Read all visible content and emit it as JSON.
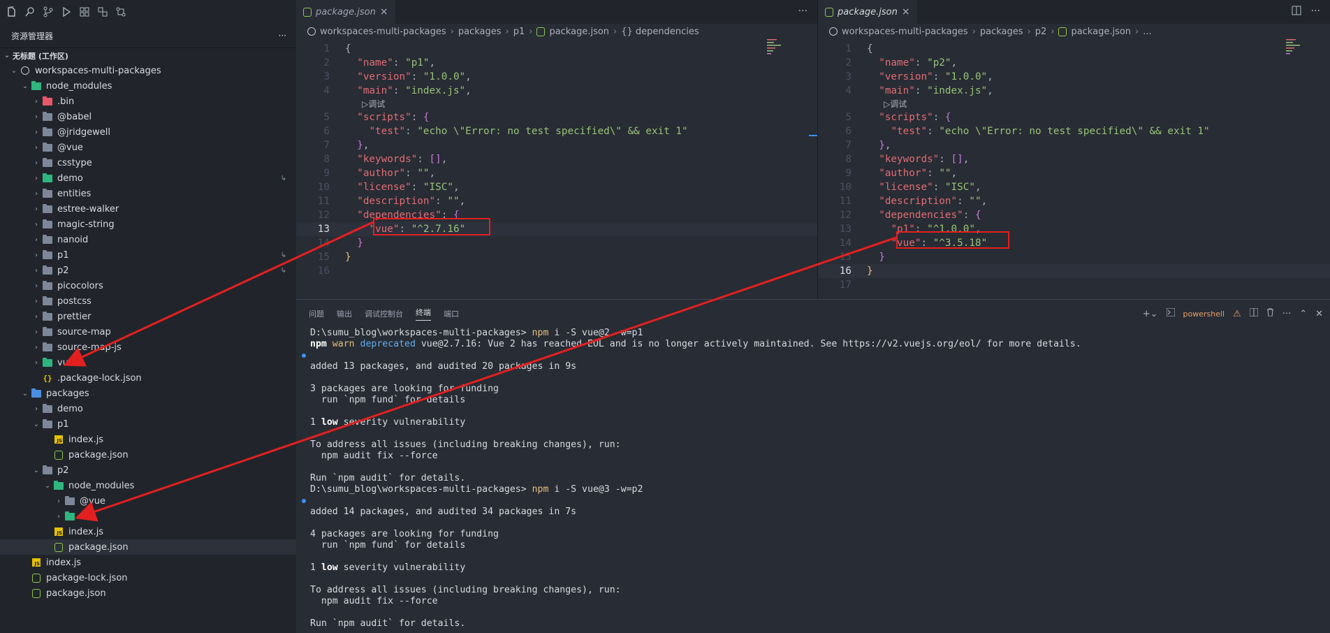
{
  "sidebar": {
    "explorer_title": "资源管理器",
    "more": "···",
    "workspace_title": "无标题 (工作区)",
    "tree": [
      {
        "label": "workspaces-multi-packages",
        "depth": 0,
        "chev": "v",
        "icon": "circle",
        "name": "tree-root"
      },
      {
        "label": "node_modules",
        "depth": 1,
        "chev": "v",
        "icon": "folder-green",
        "name": "tree-node-modules"
      },
      {
        "label": ".bin",
        "depth": 2,
        "chev": ">",
        "icon": "folder-red",
        "name": "tree-bin"
      },
      {
        "label": "@babel",
        "depth": 2,
        "chev": ">",
        "icon": "folder",
        "name": "tree-babel"
      },
      {
        "label": "@jridgewell",
        "depth": 2,
        "chev": ">",
        "icon": "folder",
        "name": "tree-jridgewell"
      },
      {
        "label": "@vue",
        "depth": 2,
        "chev": ">",
        "icon": "folder",
        "name": "tree-at-vue"
      },
      {
        "label": "csstype",
        "depth": 2,
        "chev": ">",
        "icon": "folder",
        "name": "tree-csstype"
      },
      {
        "label": "demo",
        "depth": 2,
        "chev": ">",
        "icon": "folder-green",
        "name": "tree-demo-link",
        "link": true
      },
      {
        "label": "entities",
        "depth": 2,
        "chev": ">",
        "icon": "folder",
        "name": "tree-entities"
      },
      {
        "label": "estree-walker",
        "depth": 2,
        "chev": ">",
        "icon": "folder",
        "name": "tree-estree-walker"
      },
      {
        "label": "magic-string",
        "depth": 2,
        "chev": ">",
        "icon": "folder",
        "name": "tree-magic-string"
      },
      {
        "label": "nanoid",
        "depth": 2,
        "chev": ">",
        "icon": "folder",
        "name": "tree-nanoid"
      },
      {
        "label": "p1",
        "depth": 2,
        "chev": ">",
        "icon": "folder",
        "name": "tree-p1-link",
        "link": true
      },
      {
        "label": "p2",
        "depth": 2,
        "chev": ">",
        "icon": "folder",
        "name": "tree-p2-link",
        "link": true
      },
      {
        "label": "picocolors",
        "depth": 2,
        "chev": ">",
        "icon": "folder",
        "name": "tree-picocolors"
      },
      {
        "label": "postcss",
        "depth": 2,
        "chev": ">",
        "icon": "folder",
        "name": "tree-postcss"
      },
      {
        "label": "prettier",
        "depth": 2,
        "chev": ">",
        "icon": "folder",
        "name": "tree-prettier"
      },
      {
        "label": "source-map",
        "depth": 2,
        "chev": ">",
        "icon": "folder",
        "name": "tree-source-map"
      },
      {
        "label": "source-map-js",
        "depth": 2,
        "chev": ">",
        "icon": "folder",
        "name": "tree-source-map-js"
      },
      {
        "label": "vue",
        "depth": 2,
        "chev": ">",
        "icon": "folder-green",
        "name": "tree-vue"
      },
      {
        "label": ".package-lock.json",
        "depth": 2,
        "chev": "",
        "icon": "brace",
        "name": "tree-hidden-lock"
      },
      {
        "label": "packages",
        "depth": 1,
        "chev": "v",
        "icon": "folder-blue",
        "name": "tree-packages"
      },
      {
        "label": "demo",
        "depth": 2,
        "chev": ">",
        "icon": "folder",
        "name": "tree-packages-demo"
      },
      {
        "label": "p1",
        "depth": 2,
        "chev": "v",
        "icon": "folder",
        "name": "tree-packages-p1"
      },
      {
        "label": "index.js",
        "depth": 3,
        "chev": "",
        "icon": "js",
        "name": "tree-p1-index"
      },
      {
        "label": "package.json",
        "depth": 3,
        "chev": "",
        "icon": "node",
        "name": "tree-p1-package"
      },
      {
        "label": "p2",
        "depth": 2,
        "chev": "v",
        "icon": "folder",
        "name": "tree-packages-p2"
      },
      {
        "label": "node_modules",
        "depth": 3,
        "chev": "v",
        "icon": "folder-green",
        "name": "tree-p2-node-modules"
      },
      {
        "label": "@vue",
        "depth": 4,
        "chev": ">",
        "icon": "folder",
        "name": "tree-p2-at-vue"
      },
      {
        "label": "vue",
        "depth": 4,
        "chev": ">",
        "icon": "folder-green",
        "name": "tree-p2-vue"
      },
      {
        "label": "index.js",
        "depth": 3,
        "chev": "",
        "icon": "js",
        "name": "tree-p2-index"
      },
      {
        "label": "package.json",
        "depth": 3,
        "chev": "",
        "icon": "node",
        "name": "tree-p2-package",
        "selected": true
      },
      {
        "label": "index.js",
        "depth": 1,
        "chev": "",
        "icon": "js",
        "name": "tree-root-index"
      },
      {
        "label": "package-lock.json",
        "depth": 1,
        "chev": "",
        "icon": "node",
        "name": "tree-root-lock"
      },
      {
        "label": "package.json",
        "depth": 1,
        "chev": "",
        "icon": "node",
        "name": "tree-root-package"
      }
    ]
  },
  "editor_left": {
    "tab_label": "package.json",
    "tab_close": "×",
    "more": "···",
    "breadcrumb": [
      "workspaces-multi-packages",
      "packages",
      "p1",
      "package.json",
      "{} dependencies"
    ],
    "codelens": "▷调试",
    "current_line": 13,
    "lines": [
      [
        {
          "c": "p",
          "t": "{"
        }
      ],
      [
        {
          "c": "p",
          "t": "  "
        },
        {
          "c": "k",
          "t": "\"name\""
        },
        {
          "c": "p",
          "t": ": "
        },
        {
          "c": "s",
          "t": "\"p1\""
        },
        {
          "c": "p",
          "t": ","
        }
      ],
      [
        {
          "c": "p",
          "t": "  "
        },
        {
          "c": "k",
          "t": "\"version\""
        },
        {
          "c": "p",
          "t": ": "
        },
        {
          "c": "s",
          "t": "\"1.0.0\""
        },
        {
          "c": "p",
          "t": ","
        }
      ],
      [
        {
          "c": "p",
          "t": "  "
        },
        {
          "c": "k",
          "t": "\"main\""
        },
        {
          "c": "p",
          "t": ": "
        },
        {
          "c": "s",
          "t": "\"index.js\""
        },
        {
          "c": "p",
          "t": ","
        }
      ],
      [
        {
          "c": "p",
          "t": "  "
        },
        {
          "c": "k",
          "t": "\"scripts\""
        },
        {
          "c": "p",
          "t": ": "
        },
        {
          "c": "b",
          "t": "{"
        }
      ],
      [
        {
          "c": "p",
          "t": "    "
        },
        {
          "c": "k",
          "t": "\"test\""
        },
        {
          "c": "p",
          "t": ": "
        },
        {
          "c": "s",
          "t": "\"echo \\\"Error: no test specified\\\" && exit 1\""
        }
      ],
      [
        {
          "c": "p",
          "t": "  "
        },
        {
          "c": "b",
          "t": "}"
        },
        {
          "c": "p",
          "t": ","
        }
      ],
      [
        {
          "c": "p",
          "t": "  "
        },
        {
          "c": "k",
          "t": "\"keywords\""
        },
        {
          "c": "p",
          "t": ": "
        },
        {
          "c": "b",
          "t": "[]"
        },
        {
          "c": "p",
          "t": ","
        }
      ],
      [
        {
          "c": "p",
          "t": "  "
        },
        {
          "c": "k",
          "t": "\"author\""
        },
        {
          "c": "p",
          "t": ": "
        },
        {
          "c": "s",
          "t": "\"\""
        },
        {
          "c": "p",
          "t": ","
        }
      ],
      [
        {
          "c": "p",
          "t": "  "
        },
        {
          "c": "k",
          "t": "\"license\""
        },
        {
          "c": "p",
          "t": ": "
        },
        {
          "c": "s",
          "t": "\"ISC\""
        },
        {
          "c": "p",
          "t": ","
        }
      ],
      [
        {
          "c": "p",
          "t": "  "
        },
        {
          "c": "k",
          "t": "\"description\""
        },
        {
          "c": "p",
          "t": ": "
        },
        {
          "c": "s",
          "t": "\"\""
        },
        {
          "c": "p",
          "t": ","
        }
      ],
      [
        {
          "c": "p",
          "t": "  "
        },
        {
          "c": "k",
          "t": "\"dependencies\""
        },
        {
          "c": "p",
          "t": ": "
        },
        {
          "c": "b",
          "t": "{"
        }
      ],
      [
        {
          "c": "p",
          "t": "    "
        },
        {
          "c": "k",
          "t": "\"vue\""
        },
        {
          "c": "p",
          "t": ": "
        },
        {
          "c": "s",
          "t": "\"^2.7.16\""
        }
      ],
      [
        {
          "c": "p",
          "t": "  "
        },
        {
          "c": "b",
          "t": "}"
        }
      ],
      [
        {
          "c": "y",
          "t": "}"
        }
      ],
      []
    ]
  },
  "editor_right": {
    "tab_label": "package.json",
    "tab_close": "×",
    "breadcrumb": [
      "workspaces-multi-packages",
      "packages",
      "p2",
      "package.json",
      "..."
    ],
    "codelens": "▷调试",
    "current_line": 16,
    "lines": [
      [
        {
          "c": "p",
          "t": "{"
        }
      ],
      [
        {
          "c": "p",
          "t": "  "
        },
        {
          "c": "k",
          "t": "\"name\""
        },
        {
          "c": "p",
          "t": ": "
        },
        {
          "c": "s",
          "t": "\"p2\""
        },
        {
          "c": "p",
          "t": ","
        }
      ],
      [
        {
          "c": "p",
          "t": "  "
        },
        {
          "c": "k",
          "t": "\"version\""
        },
        {
          "c": "p",
          "t": ": "
        },
        {
          "c": "s",
          "t": "\"1.0.0\""
        },
        {
          "c": "p",
          "t": ","
        }
      ],
      [
        {
          "c": "p",
          "t": "  "
        },
        {
          "c": "k",
          "t": "\"main\""
        },
        {
          "c": "p",
          "t": ": "
        },
        {
          "c": "s",
          "t": "\"index.js\""
        },
        {
          "c": "p",
          "t": ","
        }
      ],
      [
        {
          "c": "p",
          "t": "  "
        },
        {
          "c": "k",
          "t": "\"scripts\""
        },
        {
          "c": "p",
          "t": ": "
        },
        {
          "c": "b",
          "t": "{"
        }
      ],
      [
        {
          "c": "p",
          "t": "    "
        },
        {
          "c": "k",
          "t": "\"test\""
        },
        {
          "c": "p",
          "t": ": "
        },
        {
          "c": "s",
          "t": "\"echo \\\"Error: no test specified\\\" && exit 1\""
        }
      ],
      [
        {
          "c": "p",
          "t": "  "
        },
        {
          "c": "b",
          "t": "}"
        },
        {
          "c": "p",
          "t": ","
        }
      ],
      [
        {
          "c": "p",
          "t": "  "
        },
        {
          "c": "k",
          "t": "\"keywords\""
        },
        {
          "c": "p",
          "t": ": "
        },
        {
          "c": "b",
          "t": "[]"
        },
        {
          "c": "p",
          "t": ","
        }
      ],
      [
        {
          "c": "p",
          "t": "  "
        },
        {
          "c": "k",
          "t": "\"author\""
        },
        {
          "c": "p",
          "t": ": "
        },
        {
          "c": "s",
          "t": "\"\""
        },
        {
          "c": "p",
          "t": ","
        }
      ],
      [
        {
          "c": "p",
          "t": "  "
        },
        {
          "c": "k",
          "t": "\"license\""
        },
        {
          "c": "p",
          "t": ": "
        },
        {
          "c": "s",
          "t": "\"ISC\""
        },
        {
          "c": "p",
          "t": ","
        }
      ],
      [
        {
          "c": "p",
          "t": "  "
        },
        {
          "c": "k",
          "t": "\"description\""
        },
        {
          "c": "p",
          "t": ": "
        },
        {
          "c": "s",
          "t": "\"\""
        },
        {
          "c": "p",
          "t": ","
        }
      ],
      [
        {
          "c": "p",
          "t": "  "
        },
        {
          "c": "k",
          "t": "\"dependencies\""
        },
        {
          "c": "p",
          "t": ": "
        },
        {
          "c": "b",
          "t": "{"
        }
      ],
      [
        {
          "c": "p",
          "t": "    "
        },
        {
          "c": "k",
          "t": "\"p1\""
        },
        {
          "c": "p",
          "t": ": "
        },
        {
          "c": "s",
          "t": "\"^1.0.0\""
        },
        {
          "c": "p",
          "t": ","
        }
      ],
      [
        {
          "c": "p",
          "t": "    "
        },
        {
          "c": "k",
          "t": "\"vue\""
        },
        {
          "c": "p",
          "t": ": "
        },
        {
          "c": "s",
          "t": "\"^3.5.18\""
        }
      ],
      [
        {
          "c": "p",
          "t": "  "
        },
        {
          "c": "b",
          "t": "}"
        }
      ],
      [
        {
          "c": "y",
          "t": "}"
        }
      ],
      []
    ]
  },
  "panel": {
    "tabs": [
      "问题",
      "输出",
      "调试控制台",
      "终端",
      "端口"
    ],
    "active_tab": "终端",
    "shell_label": "powershell",
    "terminal": [
      {
        "dot": false,
        "parts": [
          {
            "c": "",
            "t": "D:\\sumu_blog\\workspaces-multi-packages> "
          },
          {
            "c": "cmd",
            "t": "npm"
          },
          {
            "c": "",
            "t": " i -S vue@2 -w=p1"
          }
        ]
      },
      {
        "dot": false,
        "parts": [
          {
            "c": "bold",
            "t": "npm"
          },
          {
            "c": "",
            "t": " "
          },
          {
            "c": "warn",
            "t": "warn"
          },
          {
            "c": "",
            "t": " "
          },
          {
            "c": "dep",
            "t": "deprecated"
          },
          {
            "c": "",
            "t": " vue@2.7.16: Vue 2 has reached EOL and is no longer actively maintained. See https://v2.vuejs.org/eol/ for more details."
          }
        ]
      },
      {
        "dot": true,
        "parts": []
      },
      {
        "dot": false,
        "parts": [
          {
            "c": "",
            "t": "added 13 packages, and audited 20 packages in 9s"
          }
        ]
      },
      {
        "dot": false,
        "parts": []
      },
      {
        "dot": false,
        "parts": [
          {
            "c": "",
            "t": "3 packages are looking for funding"
          }
        ]
      },
      {
        "dot": false,
        "parts": [
          {
            "c": "",
            "t": "  run `npm fund` for details"
          }
        ]
      },
      {
        "dot": false,
        "parts": []
      },
      {
        "dot": false,
        "parts": [
          {
            "c": "",
            "t": "1 "
          },
          {
            "c": "bold",
            "t": "low"
          },
          {
            "c": "",
            "t": " severity vulnerability"
          }
        ]
      },
      {
        "dot": false,
        "parts": []
      },
      {
        "dot": false,
        "parts": [
          {
            "c": "",
            "t": "To address all issues (including breaking changes), run:"
          }
        ]
      },
      {
        "dot": false,
        "parts": [
          {
            "c": "",
            "t": "  npm audit fix --force"
          }
        ]
      },
      {
        "dot": false,
        "parts": []
      },
      {
        "dot": false,
        "parts": [
          {
            "c": "",
            "t": "Run `npm audit` for details."
          }
        ]
      },
      {
        "dot": false,
        "parts": [
          {
            "c": "",
            "t": "D:\\sumu_blog\\workspaces-multi-packages> "
          },
          {
            "c": "cmd",
            "t": "npm"
          },
          {
            "c": "",
            "t": " i -S vue@3 -w=p2"
          }
        ]
      },
      {
        "dot": true,
        "parts": []
      },
      {
        "dot": false,
        "parts": [
          {
            "c": "",
            "t": "added 14 packages, and audited 34 packages in 7s"
          }
        ]
      },
      {
        "dot": false,
        "parts": []
      },
      {
        "dot": false,
        "parts": [
          {
            "c": "",
            "t": "4 packages are looking for funding"
          }
        ]
      },
      {
        "dot": false,
        "parts": [
          {
            "c": "",
            "t": "  run `npm fund` for details"
          }
        ]
      },
      {
        "dot": false,
        "parts": []
      },
      {
        "dot": false,
        "parts": [
          {
            "c": "",
            "t": "1 "
          },
          {
            "c": "bold",
            "t": "low"
          },
          {
            "c": "",
            "t": " severity vulnerability"
          }
        ]
      },
      {
        "dot": false,
        "parts": []
      },
      {
        "dot": false,
        "parts": [
          {
            "c": "",
            "t": "To address all issues (including breaking changes), run:"
          }
        ]
      },
      {
        "dot": false,
        "parts": [
          {
            "c": "",
            "t": "  npm audit fix --force"
          }
        ]
      },
      {
        "dot": false,
        "parts": []
      },
      {
        "dot": false,
        "parts": [
          {
            "c": "",
            "t": "Run `npm audit` for details."
          }
        ]
      }
    ]
  },
  "colors": {
    "annotation": "#e32020",
    "accent": "#3794ff"
  }
}
